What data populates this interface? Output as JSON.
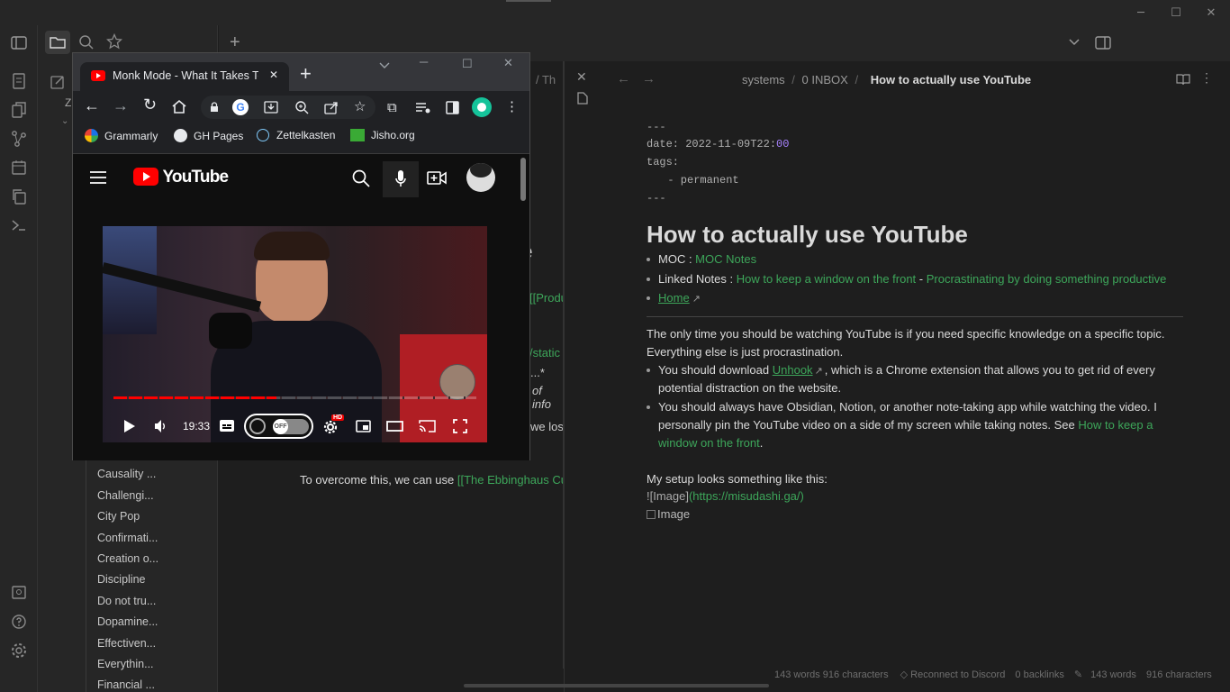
{
  "obsidian": {
    "new_tab_symbol": "+",
    "files": [
      "Causality ...",
      "Challengi...",
      "City Pop",
      "Confirmati...",
      "Creation o...",
      "Discipline",
      "Do not tru...",
      "Dopamine...",
      "Effectiven...",
      "Everythin...",
      "Financial ..."
    ],
    "folder_initial": "Z",
    "left_editor": {
      "breadcrumb_fragment": "/ Th",
      "heading_fragment": "e",
      "frag1": "[[Produ",
      "frag2": "/static",
      "frag3": "...*",
      "frag4": "of info",
      "frag5": "we los",
      "line_text": "To overcome this, we can use ",
      "line_link": "[[The Ebbinghaus Cur"
    },
    "breadcrumb": {
      "folder1": "systems",
      "sep": "/",
      "folder2": "0 INBOX",
      "current": "How to actually use YouTube"
    },
    "frontmatter": {
      "dashes": "---",
      "date_key": "date: ",
      "date_val": "2022-11-09T22:",
      "date_end": "00",
      "tags_key": "tags:",
      "tag1": "  - permanent"
    },
    "note": {
      "title": "How to actually use YouTube",
      "moc_label": "MOC : ",
      "moc_link": "MOC Notes",
      "linked_label": "Linked Notes : ",
      "linked1": "How to keep a window on the front",
      "linked_sep": " - ",
      "linked2": "Procrastinating by doing something productive",
      "home_link": "Home",
      "para1a": "The only time you should be watching YouTube is if you need specific knowledge on a specific topic.",
      "para1b": "Everything else is just procrastination.",
      "b1_pre": "You should download ",
      "b1_link": "Unhook",
      "b1_post": ", which is a Chrome extension that allows you to get rid of every",
      "b1_line2": "potential distraction on the website.",
      "b2_line1": "You should always have Obsidian, Notion, or another note-taking app while watching the video. I",
      "b2_line2": "personally pin the YouTube video on a side of my screen while taking notes. See ",
      "b2_link1": "How to keep a",
      "b2_link2": "window on the front",
      "b2_end": ".",
      "setup": "My setup looks something like this:",
      "img_md_pre": "![Image]",
      "img_md_url": "(https://misudashi.ga/)",
      "img_alt": "Image"
    },
    "status": {
      "left_words": "143 words 916 characters",
      "discord": "Reconnect to Discord",
      "backlinks": "0 backlinks",
      "right_words": "143 words",
      "right_chars": "916 characters"
    }
  },
  "chrome": {
    "tab_title": "Monk Mode - What It Takes To",
    "tab_close": "✕",
    "new_tab": "+",
    "bookmarks": [
      "Grammarly",
      "GH Pages",
      "Zettelkasten",
      "Jisho.org"
    ],
    "youtube": {
      "logo_text": "YouTube",
      "time": "19:33",
      "toggle_label": "OFF",
      "hd_badge": "HD"
    }
  },
  "colors": {
    "accent_green": "#3da65a",
    "youtube_red": "#ff0000",
    "progress_red": "#f00"
  },
  "video_progress": 0.45
}
